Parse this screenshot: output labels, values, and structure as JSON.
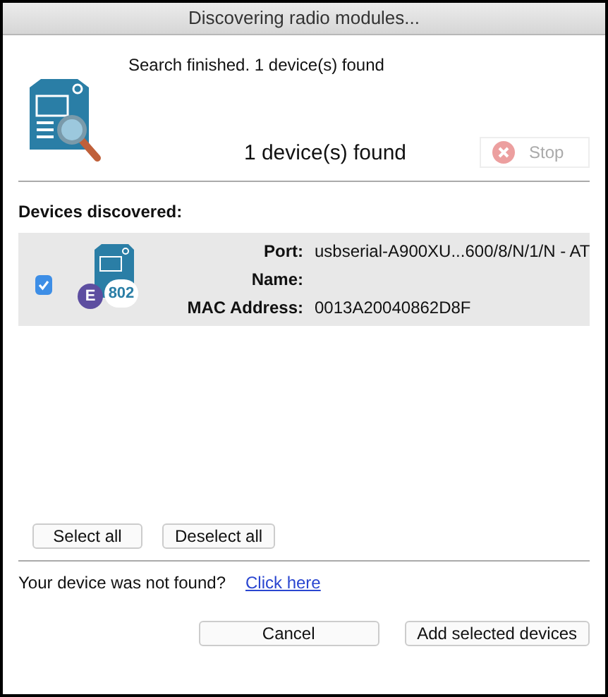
{
  "window": {
    "title": "Discovering radio modules..."
  },
  "status": {
    "message": "Search finished. 1 device(s) found",
    "count": "1 device(s) found"
  },
  "stop_button": {
    "label": "Stop",
    "disabled": true
  },
  "devices_heading": "Devices discovered:",
  "devices": [
    {
      "checked": true,
      "badge_letter": "E",
      "badge_number": "802",
      "fields": [
        {
          "label": "Port:",
          "value": "usbserial-A900XU...600/8/N/1/N - AT"
        },
        {
          "label": "Name:"
        },
        {
          "label": "MAC Address:",
          "value": "0013A20040862D8F"
        }
      ]
    }
  ],
  "select_buttons": [
    "Select all",
    "Deselect all"
  ],
  "not_found": {
    "text": "Your device was not found?",
    "link": "Click here"
  },
  "buttons": [
    "Cancel",
    "Add selected devices"
  ]
}
